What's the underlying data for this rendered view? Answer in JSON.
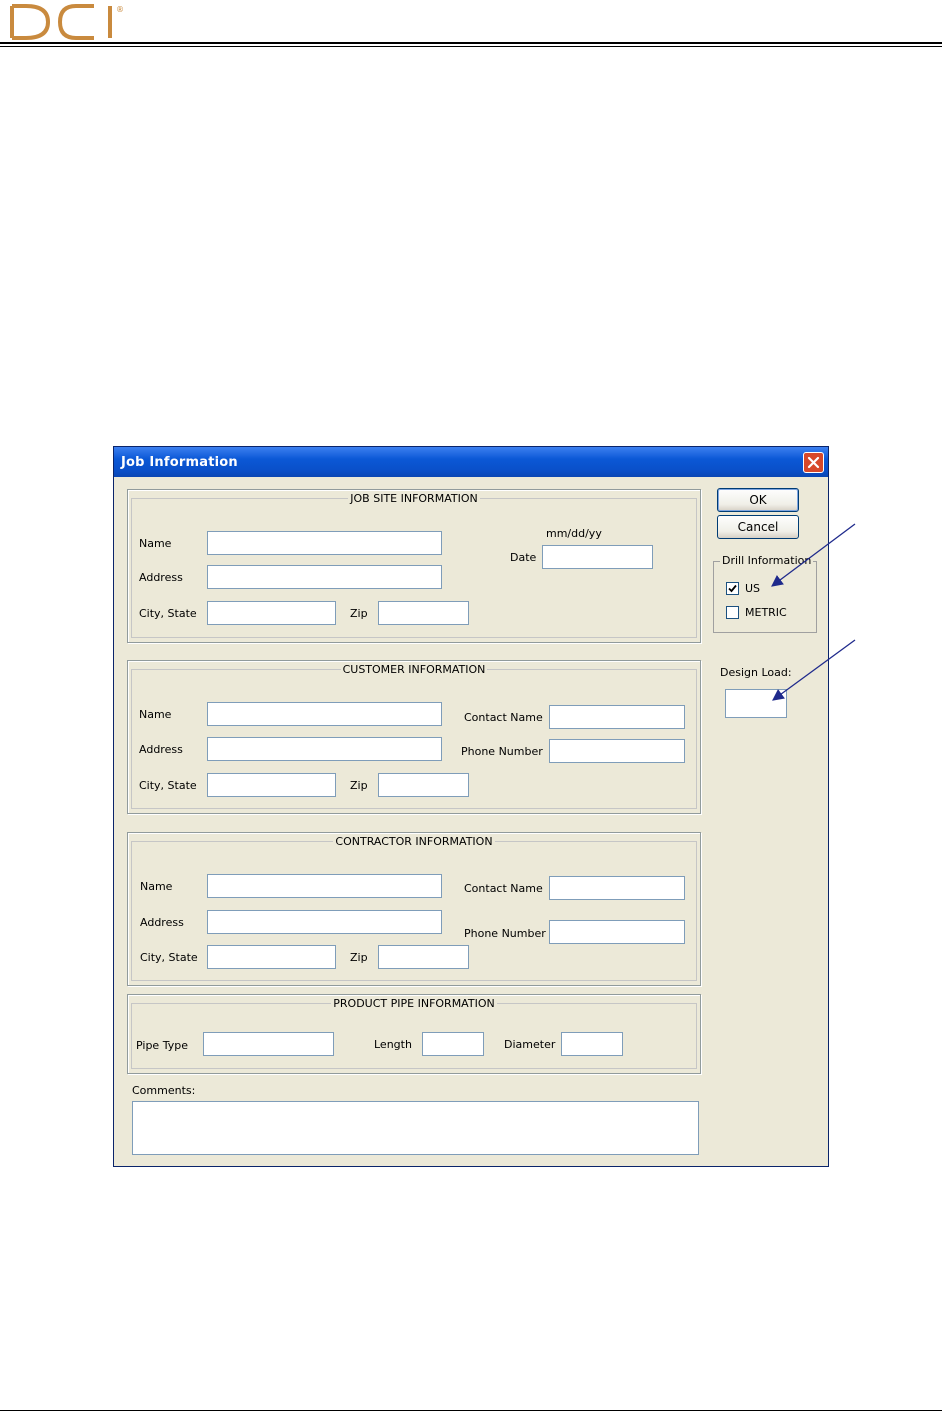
{
  "dialog": {
    "title": "Job Information",
    "buttons": {
      "ok": "OK",
      "cancel": "Cancel"
    },
    "drill_info": {
      "legend": "Drill Information",
      "options": [
        {
          "label": "US",
          "checked": true
        },
        {
          "label": "METRIC",
          "checked": false
        }
      ]
    },
    "design_load": {
      "label": "Design Load:",
      "value": ""
    },
    "job_site": {
      "legend": "JOB SITE INFORMATION",
      "name_label": "Name",
      "address_label": "Address",
      "city_state_label": "City, State",
      "zip_label": "Zip",
      "date_format": "mm/dd/yy",
      "date_label": "Date"
    },
    "customer": {
      "legend": "CUSTOMER INFORMATION",
      "name_label": "Name",
      "address_label": "Address",
      "city_state_label": "City, State",
      "zip_label": "Zip",
      "contact_name_label": "Contact Name",
      "phone_number_label": "Phone Number"
    },
    "contractor": {
      "legend": "CONTRACTOR INFORMATION",
      "name_label": "Name",
      "address_label": "Address",
      "city_state_label": "City, State",
      "zip_label": "Zip",
      "contact_name_label": "Contact Name",
      "phone_number_label": "Phone Number"
    },
    "product_pipe": {
      "legend": "PRODUCT PIPE INFORMATION",
      "pipe_type_label": "Pipe Type",
      "length_label": "Length",
      "diameter_label": "Diameter"
    },
    "comments_label": "Comments:"
  },
  "colors": {
    "logo": "#c98a3e",
    "titlebar": "#0a4fc8",
    "dialog_bg": "#ece9d8",
    "annotation_arrow": "#1f2a8c"
  },
  "icons": {
    "logo": "dci-logo",
    "close": "close-icon",
    "checkmark": "checkmark-icon",
    "arrows": "annotation-arrow"
  }
}
